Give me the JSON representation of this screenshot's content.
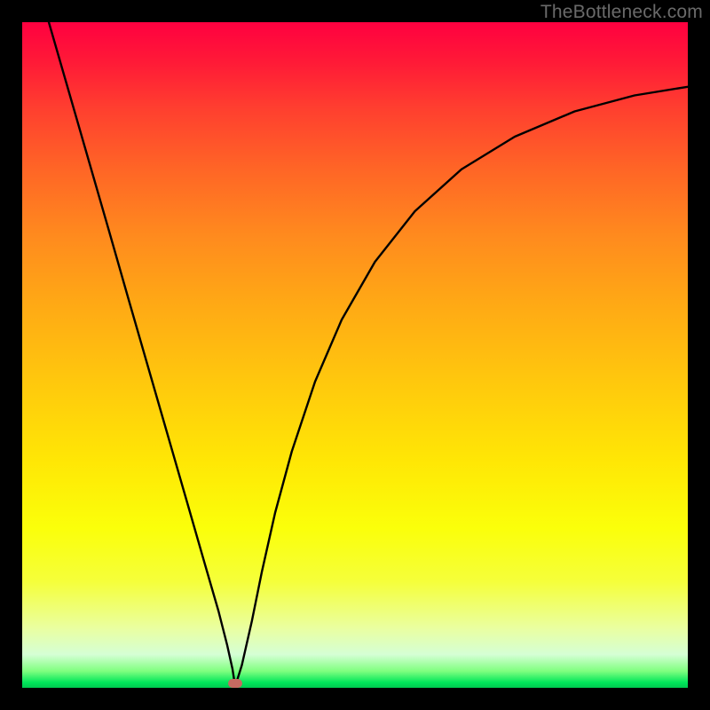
{
  "watermark": "TheBottleneck.com",
  "chart_data": {
    "type": "line",
    "title": "",
    "xlabel": "",
    "ylabel": "",
    "xlim": [
      0,
      1
    ],
    "ylim": [
      0,
      1
    ],
    "series": [
      {
        "name": "curve",
        "x": [
          0.04,
          0.07,
          0.1,
          0.13,
          0.16,
          0.19,
          0.22,
          0.25,
          0.275,
          0.295,
          0.308,
          0.316,
          0.32,
          0.33,
          0.345,
          0.36,
          0.38,
          0.405,
          0.44,
          0.48,
          0.53,
          0.59,
          0.66,
          0.74,
          0.83,
          0.92,
          1.0
        ],
        "y": [
          1.0,
          0.896,
          0.792,
          0.688,
          0.583,
          0.479,
          0.375,
          0.271,
          0.184,
          0.115,
          0.064,
          0.028,
          0.002,
          0.034,
          0.1,
          0.174,
          0.263,
          0.355,
          0.46,
          0.553,
          0.64,
          0.716,
          0.779,
          0.828,
          0.866,
          0.89,
          0.903
        ]
      }
    ],
    "marker": {
      "x": 0.32,
      "y": 0.007,
      "color": "#c66a61"
    },
    "gradient_stops": [
      {
        "offset": 0.0,
        "color": "#ff0040"
      },
      {
        "offset": 0.5,
        "color": "#ffc80d"
      },
      {
        "offset": 0.76,
        "color": "#fbff0a"
      },
      {
        "offset": 0.975,
        "color": "#7fff7f"
      },
      {
        "offset": 1.0,
        "color": "#00c950"
      }
    ]
  }
}
